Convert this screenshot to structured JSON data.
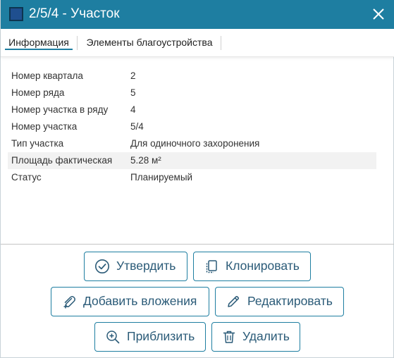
{
  "dialog": {
    "title": "2/5/4 - Участок",
    "title_color": "#1e7ea1",
    "swatch_color": "#1f4f8f"
  },
  "tabs": [
    {
      "label": "Информация",
      "active": true
    },
    {
      "label": "Элементы благоустройства",
      "active": false
    }
  ],
  "properties": [
    {
      "label": "Номер квартала",
      "value": "2"
    },
    {
      "label": "Номер ряда",
      "value": "5"
    },
    {
      "label": "Номер участка в ряду",
      "value": "4"
    },
    {
      "label": "Номер участка",
      "value": "5/4"
    },
    {
      "label": "Тип участка",
      "value": "Для одиночного захоронения"
    },
    {
      "label": "Площадь фактическая",
      "value": "5.28 м²"
    },
    {
      "label": "Статус",
      "value": "Планируемый"
    }
  ],
  "buttons": {
    "approve": {
      "label": "Утвердить",
      "icon": "check-circle-icon"
    },
    "clone": {
      "label": "Клонировать",
      "icon": "copy-icon"
    },
    "attach": {
      "label": "Добавить вложения",
      "icon": "paperclip-plus-icon"
    },
    "edit": {
      "label": "Редактировать",
      "icon": "pencil-icon"
    },
    "zoom": {
      "label": "Приблизить",
      "icon": "zoom-in-icon"
    },
    "delete": {
      "label": "Удалить",
      "icon": "trash-icon"
    }
  }
}
